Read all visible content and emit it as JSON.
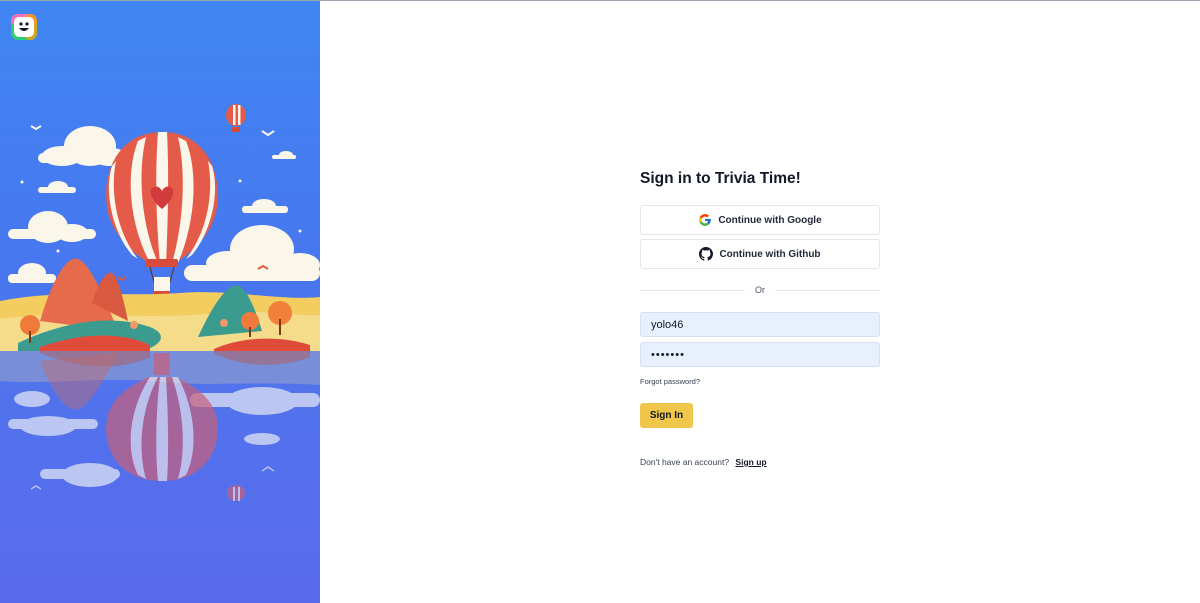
{
  "app": {
    "logo_icon": "smiley-app-icon"
  },
  "signin": {
    "title": "Sign in to Trivia Time!",
    "google_label": "Continue with Google",
    "github_label": "Continue with Github",
    "divider_text": "Or",
    "username_value": "yolo46",
    "password_value": "•••••••",
    "forgot_label": "Forgot password?",
    "submit_label": "Sign In",
    "signup_prompt": "Don't have an account?",
    "signup_link": "Sign up"
  },
  "colors": {
    "accent_button": "#f0c74a",
    "input_fill": "#e8f0fe",
    "panel_blue": "#4a73ee"
  },
  "illustration": {
    "subject": "hot-air-balloon-landscape",
    "icons": [
      "hot-air-balloon-icon",
      "cloud-icon",
      "bird-icon",
      "heart-icon",
      "tree-icon"
    ]
  }
}
